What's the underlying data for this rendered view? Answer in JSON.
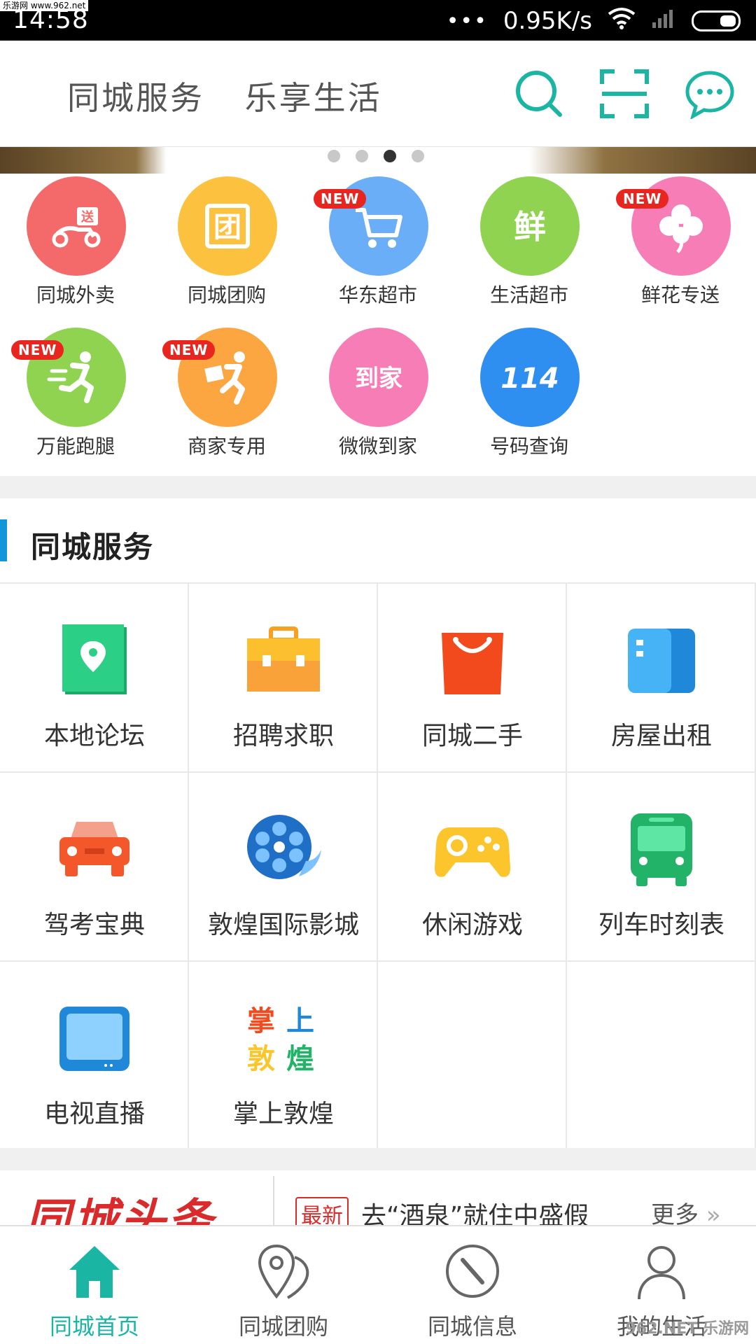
{
  "status_bar": {
    "time": "14:58",
    "watermark": "乐游网 www.962.net",
    "dots": "•••",
    "network_speed": "0.95K/s",
    "icons": [
      "wifi-icon",
      "signal-icon",
      "battery-icon"
    ]
  },
  "header": {
    "slogan_left": "同城服务",
    "slogan_right": "乐享生活",
    "icons": [
      "search-icon",
      "scan-icon",
      "message-icon"
    ],
    "accent_color": "#1bb5a4"
  },
  "banner": {
    "active_index": 2,
    "dot_count": 4
  },
  "quick": {
    "new_badge": "NEW",
    "items": [
      {
        "label": "同城外卖",
        "color": "#f46a6a",
        "icon": "scooter-icon",
        "glyph": "送",
        "is_new": false
      },
      {
        "label": "同城团购",
        "color": "#fcc23f",
        "icon": "group-buy-icon",
        "glyph": "团",
        "is_new": false
      },
      {
        "label": "华东超市",
        "color": "#6aaef7",
        "icon": "cart-icon",
        "glyph": "",
        "is_new": true
      },
      {
        "label": "生活超市",
        "color": "#8fd350",
        "icon": "fresh-icon",
        "glyph": "鲜",
        "is_new": false
      },
      {
        "label": "鲜花专送",
        "color": "#f77db6",
        "icon": "clover-icon",
        "glyph": "",
        "is_new": true
      },
      {
        "label": "万能跑腿",
        "color": "#8fd350",
        "icon": "runner-icon",
        "glyph": "",
        "is_new": true
      },
      {
        "label": "商家专用",
        "color": "#fca642",
        "icon": "delivery-man-icon",
        "glyph": "",
        "is_new": true
      },
      {
        "label": "微微到家",
        "color": "#f77db6",
        "icon": "home-delivery-icon",
        "glyph": "到家",
        "is_new": false
      },
      {
        "label": "号码查询",
        "color": "#2f8ff0",
        "icon": "phone-114-icon",
        "glyph": "114",
        "is_new": false
      }
    ]
  },
  "section": {
    "title": "同城服务"
  },
  "services": [
    {
      "label": "本地论坛",
      "icon": "location-forum-icon"
    },
    {
      "label": "招聘求职",
      "icon": "briefcase-icon"
    },
    {
      "label": "同城二手",
      "icon": "shopping-bag-icon"
    },
    {
      "label": "房屋出租",
      "icon": "door-icon"
    },
    {
      "label": "驾考宝典",
      "icon": "car-icon"
    },
    {
      "label": "敦煌国际影城",
      "icon": "film-reel-icon"
    },
    {
      "label": "休闲游戏",
      "icon": "gamepad-icon"
    },
    {
      "label": "列车时刻表",
      "icon": "bus-icon"
    },
    {
      "label": "电视直播",
      "icon": "tv-icon"
    },
    {
      "label": "掌上敦煌",
      "icon": "zhangshang-dunhuang-logo",
      "logo_chars": [
        "掌",
        "上",
        "敦",
        "煌"
      ]
    },
    {
      "label": "",
      "icon": ""
    },
    {
      "label": "",
      "icon": ""
    }
  ],
  "news": {
    "logo": "同城头条",
    "badge": "最新",
    "headline": "去“酒泉”就住中盛假",
    "more": "更多"
  },
  "bottom_nav": {
    "items": [
      {
        "label": "同城首页",
        "icon": "home-icon",
        "active": true
      },
      {
        "label": "同城团购",
        "icon": "map-pin-icon",
        "active": false
      },
      {
        "label": "同城信息",
        "icon": "compass-icon",
        "active": false
      },
      {
        "label": "我的生活",
        "icon": "user-icon",
        "active": false
      }
    ],
    "watermark": "962.NET 乐游网"
  }
}
